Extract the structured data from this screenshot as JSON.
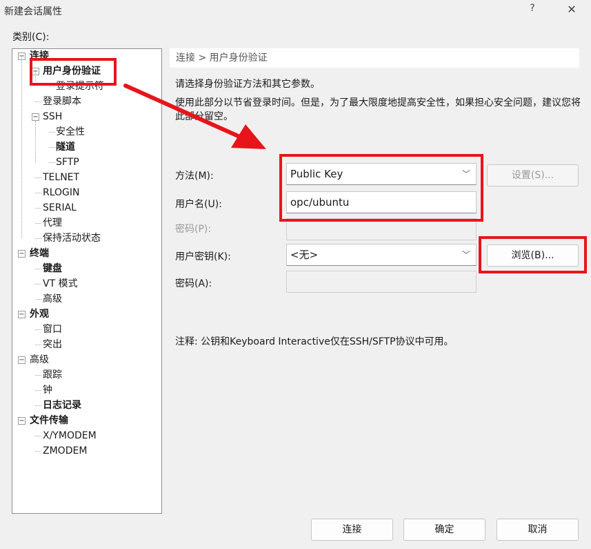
{
  "window": {
    "title": "新建会话属性",
    "help_label": "?",
    "close_label": "✕"
  },
  "category_label": "类别(C):",
  "tree": {
    "items": [
      {
        "label": "连接",
        "level": 0,
        "toggle": "−",
        "bold": true
      },
      {
        "label": "用户身份验证",
        "level": 1,
        "toggle": "−",
        "bold": true,
        "selected": true
      },
      {
        "label": "登录提示符",
        "level": 2
      },
      {
        "label": "登录脚本",
        "level": 1
      },
      {
        "label": "SSH",
        "level": 1,
        "toggle": "−"
      },
      {
        "label": "安全性",
        "level": 2
      },
      {
        "label": "隧道",
        "level": 2,
        "bold": true
      },
      {
        "label": "SFTP",
        "level": 2
      },
      {
        "label": "TELNET",
        "level": 1
      },
      {
        "label": "RLOGIN",
        "level": 1
      },
      {
        "label": "SERIAL",
        "level": 1
      },
      {
        "label": "代理",
        "level": 1
      },
      {
        "label": "保持活动状态",
        "level": 1
      },
      {
        "label": "终端",
        "level": 0,
        "toggle": "−",
        "bold": true
      },
      {
        "label": "键盘",
        "level": 1,
        "bold": true
      },
      {
        "label": "VT 模式",
        "level": 1
      },
      {
        "label": "高级",
        "level": 1
      },
      {
        "label": "外观",
        "level": 0,
        "toggle": "−",
        "bold": true
      },
      {
        "label": "窗口",
        "level": 1
      },
      {
        "label": "突出",
        "level": 1
      },
      {
        "label": "高级",
        "level": 0,
        "toggle": "−"
      },
      {
        "label": "跟踪",
        "level": 1
      },
      {
        "label": "钟",
        "level": 1
      },
      {
        "label": "日志记录",
        "level": 1,
        "bold": true
      },
      {
        "label": "文件传输",
        "level": 0,
        "toggle": "−",
        "bold": true
      },
      {
        "label": "X/YMODEM",
        "level": 1
      },
      {
        "label": "ZMODEM",
        "level": 1
      }
    ]
  },
  "panel": {
    "breadcrumb": "连接 > 用户身份验证",
    "description_1": "请选择身份验证方法和其它参数。",
    "description_2": "使用此部分以节省登录时间。但是，为了最大限度地提高安全性，如果担心安全问题，建议您将此部分留空。",
    "method_label": "方法(M):",
    "method_value": "Public Key",
    "settings_button": "设置(S)...",
    "username_label": "用户名(U):",
    "username_value": "opc/ubuntu",
    "password_label": "密码(P):",
    "password_value": "",
    "user_key_label": "用户密钥(K):",
    "user_key_value": "<无>",
    "browse_button": "浏览(B)...",
    "passphrase_label": "密码(A):",
    "passphrase_value": "",
    "note": "注释: 公钥和Keyboard Interactive仅在SSH/SFTP协议中可用。"
  },
  "footer": {
    "connect_button": "连接",
    "ok_button": "确定",
    "cancel_button": "取消"
  },
  "colors": {
    "annotation_red": "#e8141b",
    "dialog_background": "#f0f0f0"
  },
  "icons": {
    "chevron": "chevron-down-icon",
    "tree_toggle": "collapse-icon"
  }
}
